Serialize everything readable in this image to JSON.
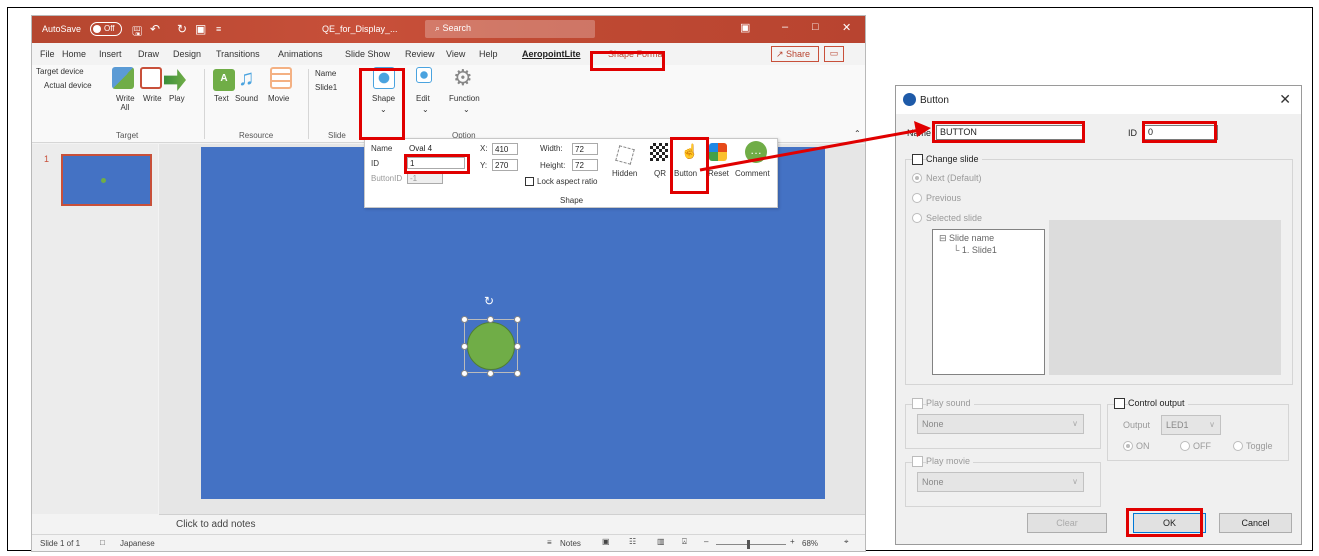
{
  "ppt": {
    "autosave": "AutoSave",
    "autosave_state": "Off",
    "doc_title": "QE_for_Display_...",
    "search": "Search",
    "tabs": [
      "File",
      "Home",
      "Insert",
      "Draw",
      "Design",
      "Transitions",
      "Animations",
      "Slide Show",
      "Review",
      "View",
      "Help",
      "AeropointLite",
      "Shape Format"
    ],
    "share": "Share",
    "ribbon": {
      "target_device": "Target device",
      "actual_device": "Actual device",
      "write_all": "Write All",
      "write": "Write",
      "play": "Play",
      "text": "Text",
      "sound": "Sound",
      "movie": "Movie",
      "name_label": "Name",
      "slide_name": "Slide1",
      "shape": "Shape",
      "edit": "Edit",
      "function": "Function",
      "groups": [
        "Target",
        "Resource",
        "Slide",
        "Option"
      ]
    },
    "slide_number": "1",
    "notes": "Click to add notes",
    "status": {
      "slide": "Slide 1 of 1",
      "lang": "Japanese",
      "notes": "Notes",
      "zoom": "68%"
    },
    "popup": {
      "name_label": "Name",
      "name_value": "Oval 4",
      "id_label": "ID",
      "id_value": "1",
      "buttonid_label": "ButtonID",
      "buttonid_value": "-1",
      "x_label": "X:",
      "x_value": "410",
      "y_label": "Y:",
      "y_value": "270",
      "width_label": "Width:",
      "width_value": "72",
      "height_label": "Height:",
      "height_value": "72",
      "lock": "Lock aspect ratio",
      "hidden": "Hidden",
      "qr": "QR",
      "button": "Button",
      "reset": "Reset",
      "comment": "Comment",
      "group": "Shape"
    }
  },
  "dialog": {
    "title": "Button",
    "name_label": "Name",
    "name_value": "BUTTON",
    "id_label": "ID",
    "id_value": "0",
    "change_slide": "Change slide",
    "next": "Next (Default)",
    "previous": "Previous",
    "selected_slide": "Selected slide",
    "tree_root": "Slide name",
    "tree_child": "1. Slide1",
    "play_sound": "Play sound",
    "sound_value": "None",
    "play_movie": "Play movie",
    "movie_value": "None",
    "control_output": "Control output",
    "output_label": "Output",
    "output_value": "LED1",
    "on": "ON",
    "off": "OFF",
    "toggle": "Toggle",
    "clear": "Clear",
    "ok": "OK",
    "cancel": "Cancel"
  },
  "colors": {
    "accent": "#c8503a",
    "slide_bg": "#4472c4",
    "oval": "#70ad47",
    "highlight": "#e00000"
  }
}
